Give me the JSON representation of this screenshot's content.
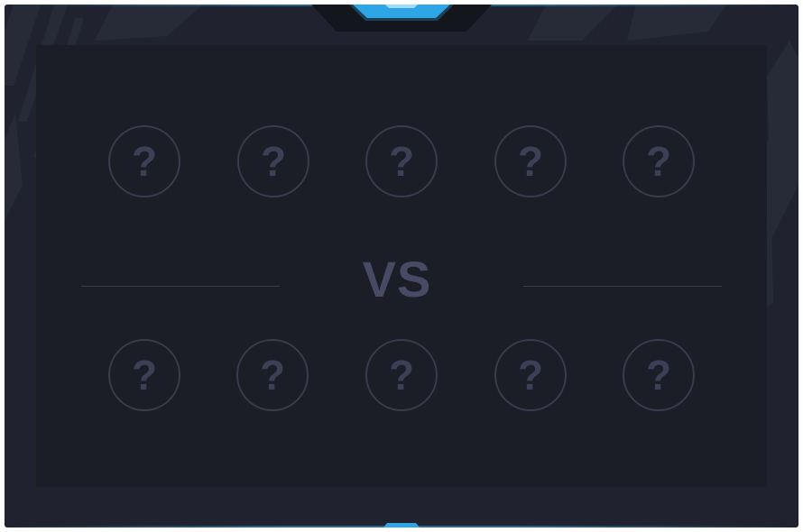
{
  "colors": {
    "accent": "#2ea6e6",
    "frame": "#20232f",
    "panel": "#1b1d27",
    "slot_border": "#393b4e",
    "text_muted": "#464a63"
  },
  "match": {
    "vs_label": "VS",
    "team_top": [
      {
        "symbol": "?"
      },
      {
        "symbol": "?"
      },
      {
        "symbol": "?"
      },
      {
        "symbol": "?"
      },
      {
        "symbol": "?"
      }
    ],
    "team_bottom": [
      {
        "symbol": "?"
      },
      {
        "symbol": "?"
      },
      {
        "symbol": "?"
      },
      {
        "symbol": "?"
      },
      {
        "symbol": "?"
      }
    ]
  }
}
